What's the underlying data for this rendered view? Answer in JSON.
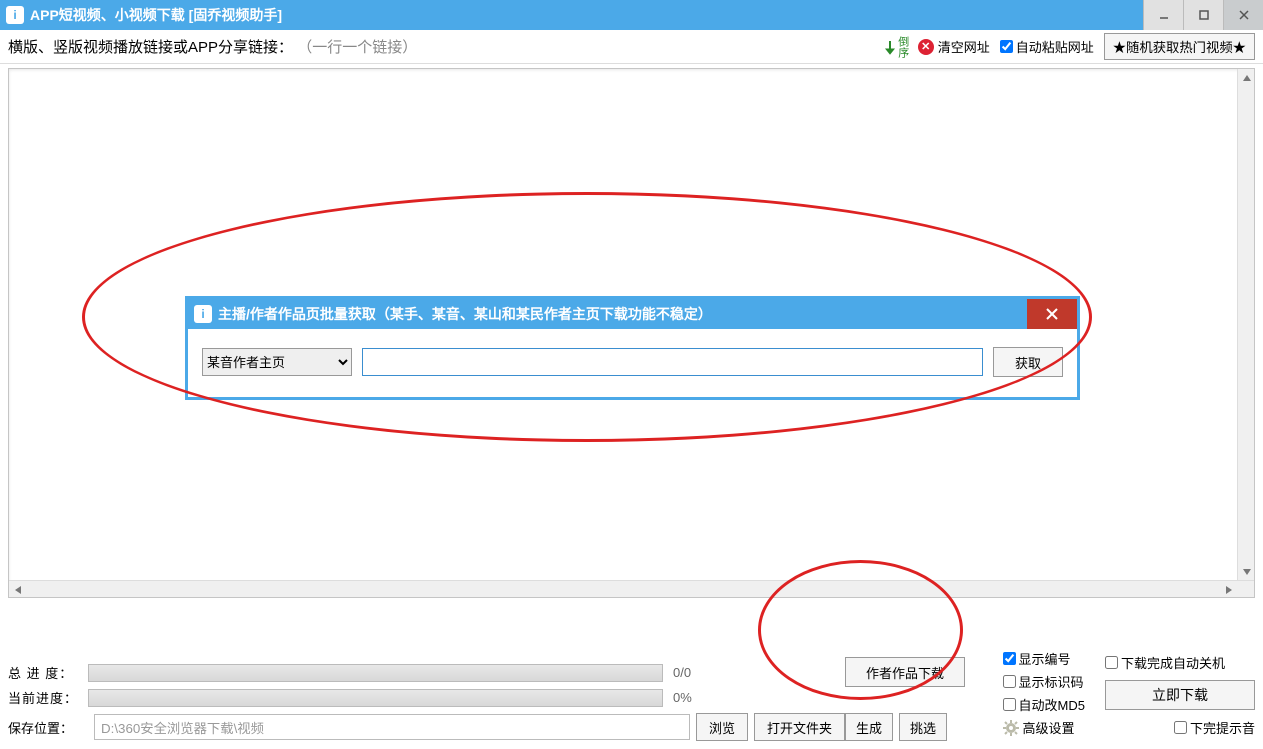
{
  "window": {
    "title": "APP短视频、小视频下载 [固乔视频助手]"
  },
  "toolbar": {
    "hint_main": "横版、竖版视频播放链接或APP分享链接：",
    "hint_grey": "（一行一个链接）",
    "reverse_order": "倒序",
    "clear_url": "清空网址",
    "auto_paste": "自动粘贴网址",
    "random_hot": "★随机获取热门视频★"
  },
  "dialog": {
    "title": "主播/作者作品页批量获取（某手、某音、某山和某民作者主页下载功能不稳定）",
    "select_value": "某音作者主页",
    "url_value": "",
    "get_btn": "获取"
  },
  "progress": {
    "total_label": "总 进 度：",
    "total_text": "0/0",
    "current_label": "当前进度：",
    "current_text": "0%"
  },
  "save": {
    "label": "保存位置：",
    "path": "D:\\360安全浏览器下载\\视频",
    "browse": "浏览",
    "open_folder": "打开文件夹"
  },
  "mid": {
    "author_download": "作者作品下载",
    "generate": "生成",
    "pick": "挑选"
  },
  "options": {
    "show_number": "显示编号",
    "show_id": "显示标识码",
    "auto_md5": "自动改MD5",
    "advanced": "高级设置"
  },
  "download": {
    "auto_shutdown": "下载完成自动关机",
    "now": "立即下载",
    "sound": "下完提示音"
  }
}
